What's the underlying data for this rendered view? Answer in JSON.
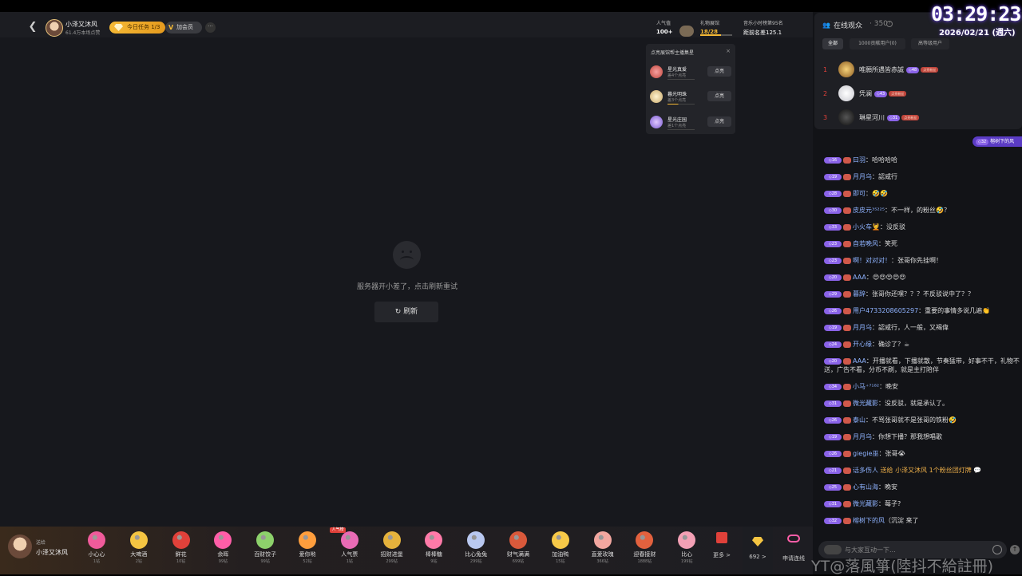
{
  "overlay": {
    "clock": "03:29:23",
    "date": "2026/02/21 (週六)",
    "watermark": "YT@落風箏(陸抖不給註冊)"
  },
  "header": {
    "host_name": "小泽又沐风",
    "host_sub": "61.4万本场点赞",
    "task_label": "今日任务 1/3",
    "join_label": "加会员",
    "more": "···",
    "popularity_label": "人气值",
    "popularity_value": "100+",
    "rank_label": "礼物展馆",
    "rank_value": "18/28",
    "hourly_label": "音乐小时榜第95名",
    "hourly_value": "距前名差125.1"
  },
  "lightup": {
    "title": "点亮展馆帮主播集星",
    "close": "×",
    "items": [
      {
        "name": "星光真爱",
        "need": "差4个点亮",
        "button": "点亮"
      },
      {
        "name": "暮光明珠",
        "need": "差3个点亮",
        "button": "点亮"
      },
      {
        "name": "星光庄园",
        "need": "差1个点亮",
        "button": "点亮"
      }
    ]
  },
  "error": {
    "message": "服务器开小差了，点击刷新重试",
    "refresh": "刷新"
  },
  "giftbar": {
    "give_label": "送给",
    "host": "小泽又沐风",
    "hot_tag": "人气榜",
    "gifts": [
      {
        "name": "小心心",
        "price": "1钻",
        "color": "#f05b9b"
      },
      {
        "name": "大啤酒",
        "price": "2钻",
        "color": "#f5c542"
      },
      {
        "name": "鲜花",
        "price": "10钻",
        "color": "#e0413a"
      },
      {
        "name": "余晖",
        "price": "99钻",
        "color": "#ff5ea8"
      },
      {
        "name": "百财饺子",
        "price": "99钻",
        "color": "#8dd16b"
      },
      {
        "name": "爱你哟",
        "price": "52钻",
        "color": "#ff9e3d"
      },
      {
        "name": "人气票",
        "price": "1钻",
        "color": "#e96bb5"
      },
      {
        "name": "招财进堡",
        "price": "299钻",
        "color": "#e5b23c"
      },
      {
        "name": "棒棒糖",
        "price": "9钻",
        "color": "#ff7aa8"
      },
      {
        "name": "比心兔兔",
        "price": "299钻",
        "color": "#b9c8f0"
      },
      {
        "name": "财气满满",
        "price": "699钻",
        "color": "#d9593b"
      },
      {
        "name": "加油鸭",
        "price": "15钻",
        "color": "#f7c948"
      },
      {
        "name": "直爱玫瑰",
        "price": "366钻",
        "color": "#f2a7a0"
      },
      {
        "name": "迎春接财",
        "price": "1888钻",
        "color": "#e2613e"
      },
      {
        "name": "比心",
        "price": "199钻",
        "color": "#f3a0b5"
      }
    ],
    "more": "更多 >",
    "diamonds": "692 >",
    "connect": "申请连线"
  },
  "viewers": {
    "title": "在线观众",
    "count": "· 350",
    "tabs": [
      "全部",
      "1000贡献用户(0)",
      "高等级用户"
    ],
    "list": [
      {
        "rank": "1",
        "name": "唯願所遇皆赤誠",
        "level": "48"
      },
      {
        "rank": "2",
        "name": "凭澜",
        "level": "43"
      },
      {
        "rank": "3",
        "name": "琳星河川",
        "level": "31"
      }
    ],
    "fan_tag": "点亮粉丝",
    "flash_level": "32",
    "flash_name": "榕树下的风"
  },
  "chat": [
    {
      "lv": "16",
      "user": "曰羽",
      "text": "：哈哈哈哈"
    },
    {
      "lv": "19",
      "user": "月月乌",
      "text": "：認咸行"
    },
    {
      "lv": "28",
      "user": "即可",
      "text": "：🤣🤣"
    },
    {
      "lv": "30",
      "user": "皮皮元³⁵²²⁵",
      "text": "：不一样，的粉丝🤣？"
    },
    {
      "lv": "33",
      "user": "小火车💆",
      "text": "：没反驳"
    },
    {
      "lv": "23",
      "user": "自若晚风",
      "text": "：笑死"
    },
    {
      "lv": "23",
      "user": "啊！对对对！",
      "text": "：张哥你先挂啊！"
    },
    {
      "lv": "20",
      "user": "AAA",
      "text": "：😍😍😍😍😍"
    },
    {
      "lv": "29",
      "user": "暮辞",
      "text": "：张哥你还嘿？？？不反驳说中了？？"
    },
    {
      "lv": "26",
      "user": "用户4733208605297",
      "text": "：重要的事情多说几遍👏"
    },
    {
      "lv": "19",
      "user": "月月乌",
      "text": "：認咸行，人一般，又褐偉"
    },
    {
      "lv": "24",
      "user": "开心缘",
      "text": "：确诊了？☕"
    },
    {
      "lv": "20",
      "user": "AAA",
      "text": "：开播就看，下播就散，节奏猛带，好事不干，礼物不送，广告不看，分币不刷，就是主打陪伴"
    },
    {
      "lv": "34",
      "user": "小马⁺⁷¹⁸²",
      "text": "：晚安"
    },
    {
      "lv": "31",
      "user": "微光藏影",
      "text": "：没反驳，就是承认了。"
    },
    {
      "lv": "26",
      "user": "泰山",
      "text": "：不骂张哥就不是张哥的铁粉🤣"
    },
    {
      "lv": "19",
      "user": "月月乌",
      "text": "：你想下播？那我想唱歌"
    },
    {
      "lv": "26",
      "user": "giegie巫",
      "text": "：张哥😭"
    },
    {
      "lv": "21",
      "user": "话多伤人",
      "text": " 送给 小泽又沐风 1个粉丝团灯牌 💬",
      "gift": true
    },
    {
      "lv": "25",
      "user": "心有山海",
      "text": "：晚安"
    },
    {
      "lv": "31",
      "user": "微光藏影",
      "text": "：莓子?"
    },
    {
      "lv": "32",
      "user": "榕树下的风",
      "text": "（沉淀 来了"
    }
  ],
  "input": {
    "placeholder": "与大家互动一下..."
  },
  "colors": {
    "accent": "#8a63e8",
    "gold": "#f5b935",
    "rank_red": "#e0413a"
  }
}
